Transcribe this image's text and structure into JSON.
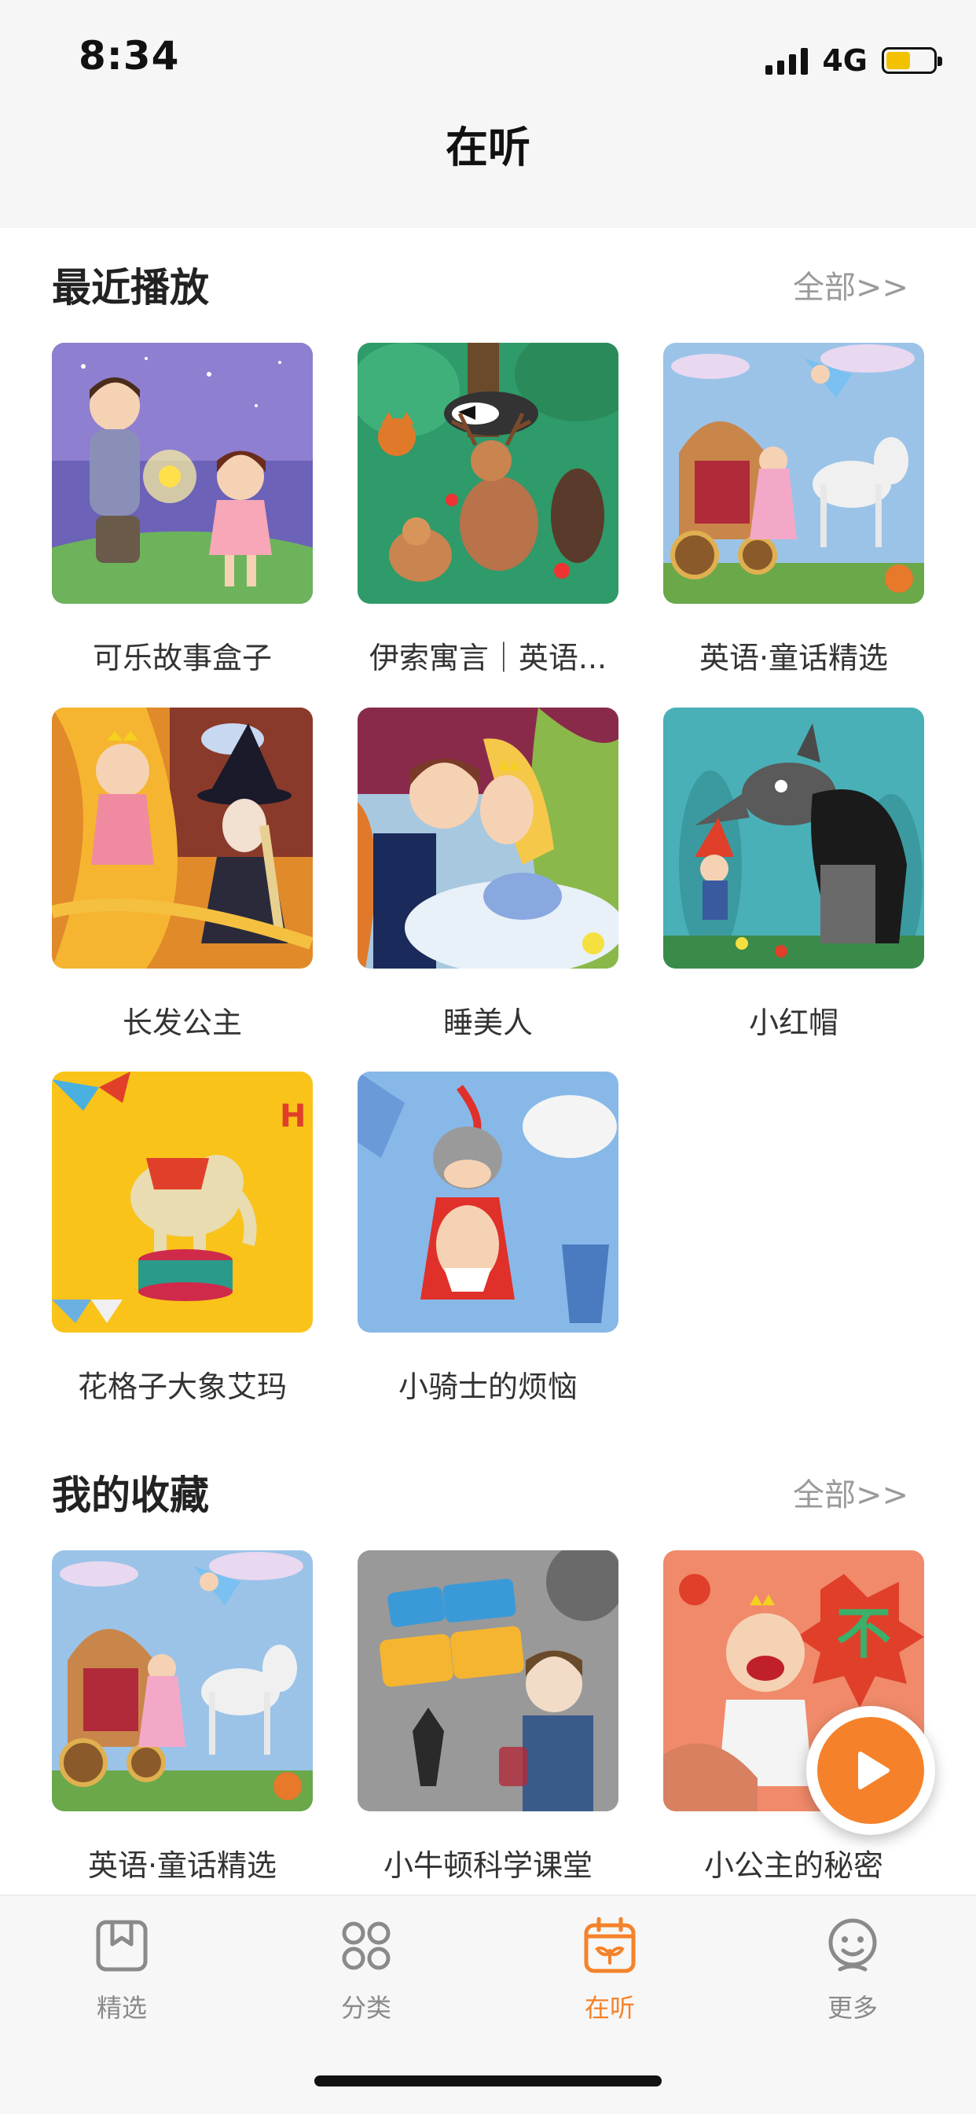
{
  "status": {
    "time": "8:34",
    "network": "4G",
    "battery_color": "#f2c200"
  },
  "header": {
    "title": "在听"
  },
  "recent": {
    "title": "最近播放",
    "see_all": "全部>>",
    "items": [
      {
        "label": "可乐故事盒子",
        "art": "night-boy-girl"
      },
      {
        "label": "伊索寓言｜英语...",
        "art": "forest-animals"
      },
      {
        "label": "英语·童话精选",
        "art": "carriage-princess"
      },
      {
        "label": "长发公主",
        "art": "rapunzel-witch"
      },
      {
        "label": "睡美人",
        "art": "sleeping-beauty"
      },
      {
        "label": "小红帽",
        "art": "wolf-red-hood"
      },
      {
        "label": "花格子大象艾玛",
        "art": "elephant-circus"
      },
      {
        "label": "小骑士的烦恼",
        "art": "little-knight"
      }
    ]
  },
  "favorites": {
    "title": "我的收藏",
    "see_all": "全部>>",
    "items": [
      {
        "label": "英语·童话精选",
        "art": "carriage-princess"
      },
      {
        "label": "小牛顿科学课堂",
        "art": "science-class"
      },
      {
        "label": "小公主的秘密",
        "art": "crying-princess"
      }
    ]
  },
  "tabs": [
    {
      "label": "精选",
      "icon": "bookmark-icon",
      "active": false
    },
    {
      "label": "分类",
      "icon": "grid-icon",
      "active": false
    },
    {
      "label": "在听",
      "icon": "calendar-sprout-icon",
      "active": true
    },
    {
      "label": "更多",
      "icon": "smiley-icon",
      "active": false
    }
  ],
  "colors": {
    "accent": "#f5822a",
    "inactive": "#8a8a8a"
  }
}
